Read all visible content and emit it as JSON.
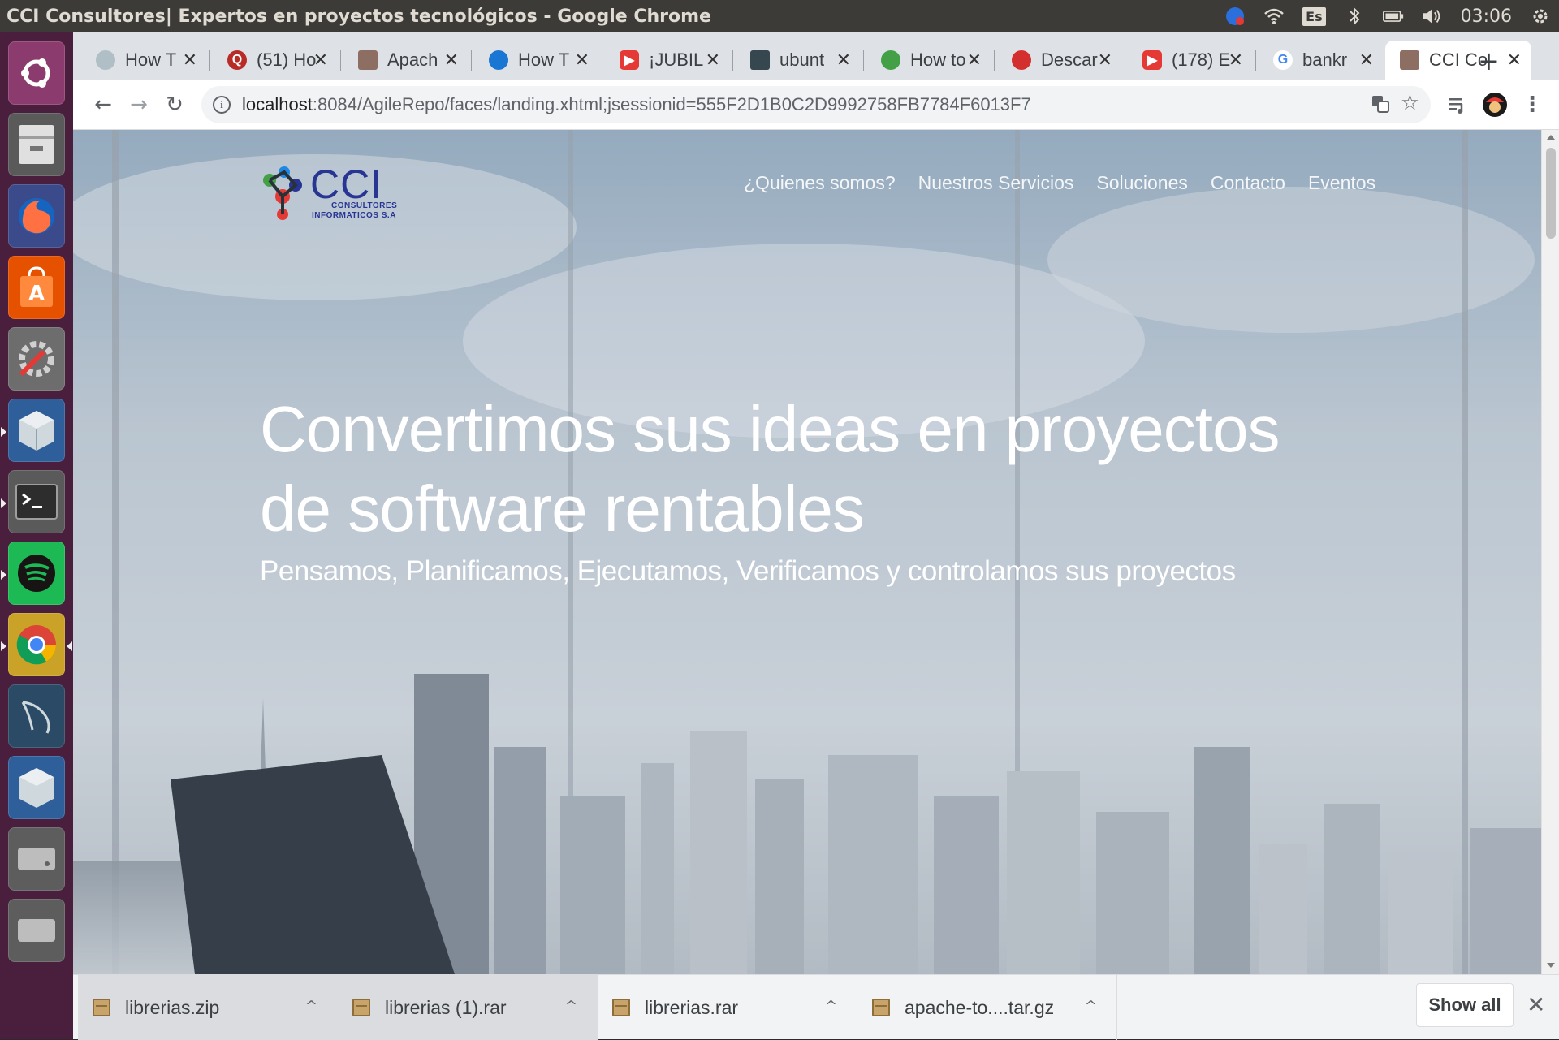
{
  "window": {
    "title": "CCI Consultores| Expertos en proyectos tecnológicos - Google Chrome"
  },
  "system_tray": {
    "keyboard_layout": "Es",
    "clock": "03:06"
  },
  "launcher": {
    "items": [
      {
        "name": "ubuntu-dash",
        "icon": "ubuntu-logo-icon"
      },
      {
        "name": "files",
        "icon": "file-cabinet-icon"
      },
      {
        "name": "firefox",
        "icon": "firefox-icon"
      },
      {
        "name": "software-center",
        "icon": "shopping-bag-icon"
      },
      {
        "name": "system-settings",
        "icon": "wrench-gear-icon"
      },
      {
        "name": "virtualbox-1",
        "icon": "cube-icon"
      },
      {
        "name": "terminal",
        "icon": "terminal-icon"
      },
      {
        "name": "spotify",
        "icon": "spotify-icon"
      },
      {
        "name": "chrome",
        "icon": "chrome-icon"
      },
      {
        "name": "mysql-workbench",
        "icon": "dolphin-icon"
      },
      {
        "name": "virtualbox-2",
        "icon": "cube-icon"
      },
      {
        "name": "disk",
        "icon": "hard-drive-icon"
      },
      {
        "name": "disk-2",
        "icon": "hard-drive-icon"
      }
    ]
  },
  "browser": {
    "tabs": [
      {
        "label": "How T",
        "favicon_color": "#b0bec5"
      },
      {
        "label": "(51) Ho",
        "favicon_color": "#b92b27"
      },
      {
        "label": "Apach",
        "favicon_color": "#8d6e63"
      },
      {
        "label": "How T",
        "favicon_color": "#1976d2"
      },
      {
        "label": "¡JUBIL",
        "favicon_color": "#e53935"
      },
      {
        "label": "ubunt",
        "favicon_color": "#37474f"
      },
      {
        "label": "How to",
        "favicon_color": "#43a047"
      },
      {
        "label": "Descar",
        "favicon_color": "#d32f2f"
      },
      {
        "label": "(178) E",
        "favicon_color": "#e53935"
      },
      {
        "label": "bankr",
        "favicon_color": "#4285f4"
      },
      {
        "label": "CCI Co",
        "favicon_color": "#8d6e63"
      }
    ],
    "new_tab": "+",
    "url": {
      "host": "localhost",
      "rest": ":8084/AgileRepo/faces/landing.xhtml;jsessionid=555F2D1B0C2D9992758FB7784F6013F7"
    }
  },
  "page": {
    "logo": {
      "title": "CCI",
      "sub1": "CONSULTORES",
      "sub2": "INFORMATICOS S.A"
    },
    "nav": [
      "¿Quienes somos?",
      "Nuestros Servicios",
      "Soluciones",
      "Contacto",
      "Eventos"
    ],
    "hero": {
      "title": "Convertimos sus ideas en proyectos de software rentables",
      "subtitle": "Pensamos, Planificamos, Ejecutamos, Verificamos y controlamos sus proyectos"
    }
  },
  "downloads": {
    "items": [
      "librerias.zip",
      "librerias (1).rar",
      "librerias.rar",
      "apache-to....tar.gz"
    ],
    "show_all": "Show all"
  }
}
